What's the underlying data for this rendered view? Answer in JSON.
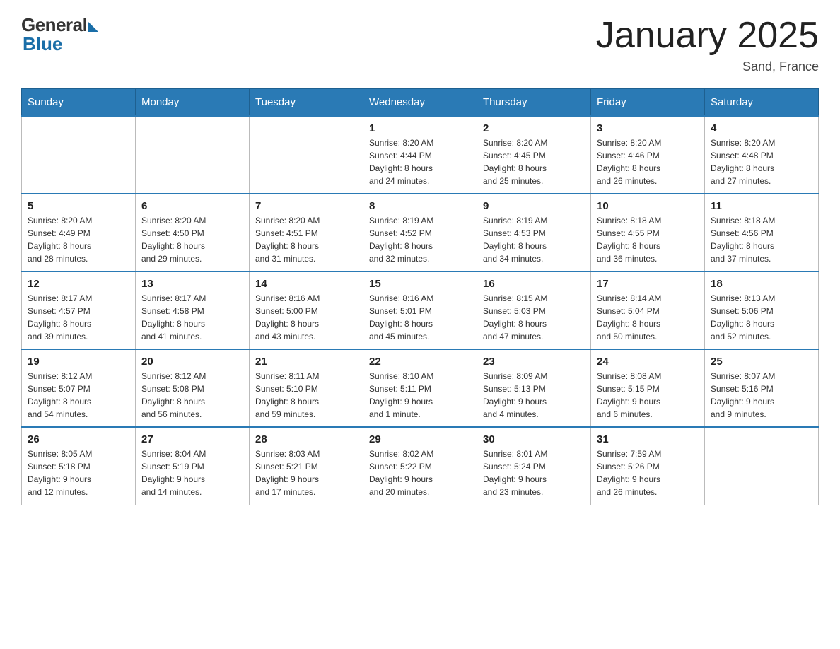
{
  "header": {
    "logo_general": "General",
    "logo_blue": "Blue",
    "title": "January 2025",
    "location": "Sand, France"
  },
  "days_of_week": [
    "Sunday",
    "Monday",
    "Tuesday",
    "Wednesday",
    "Thursday",
    "Friday",
    "Saturday"
  ],
  "weeks": [
    [
      {
        "day": "",
        "info": ""
      },
      {
        "day": "",
        "info": ""
      },
      {
        "day": "",
        "info": ""
      },
      {
        "day": "1",
        "info": "Sunrise: 8:20 AM\nSunset: 4:44 PM\nDaylight: 8 hours\nand 24 minutes."
      },
      {
        "day": "2",
        "info": "Sunrise: 8:20 AM\nSunset: 4:45 PM\nDaylight: 8 hours\nand 25 minutes."
      },
      {
        "day": "3",
        "info": "Sunrise: 8:20 AM\nSunset: 4:46 PM\nDaylight: 8 hours\nand 26 minutes."
      },
      {
        "day": "4",
        "info": "Sunrise: 8:20 AM\nSunset: 4:48 PM\nDaylight: 8 hours\nand 27 minutes."
      }
    ],
    [
      {
        "day": "5",
        "info": "Sunrise: 8:20 AM\nSunset: 4:49 PM\nDaylight: 8 hours\nand 28 minutes."
      },
      {
        "day": "6",
        "info": "Sunrise: 8:20 AM\nSunset: 4:50 PM\nDaylight: 8 hours\nand 29 minutes."
      },
      {
        "day": "7",
        "info": "Sunrise: 8:20 AM\nSunset: 4:51 PM\nDaylight: 8 hours\nand 31 minutes."
      },
      {
        "day": "8",
        "info": "Sunrise: 8:19 AM\nSunset: 4:52 PM\nDaylight: 8 hours\nand 32 minutes."
      },
      {
        "day": "9",
        "info": "Sunrise: 8:19 AM\nSunset: 4:53 PM\nDaylight: 8 hours\nand 34 minutes."
      },
      {
        "day": "10",
        "info": "Sunrise: 8:18 AM\nSunset: 4:55 PM\nDaylight: 8 hours\nand 36 minutes."
      },
      {
        "day": "11",
        "info": "Sunrise: 8:18 AM\nSunset: 4:56 PM\nDaylight: 8 hours\nand 37 minutes."
      }
    ],
    [
      {
        "day": "12",
        "info": "Sunrise: 8:17 AM\nSunset: 4:57 PM\nDaylight: 8 hours\nand 39 minutes."
      },
      {
        "day": "13",
        "info": "Sunrise: 8:17 AM\nSunset: 4:58 PM\nDaylight: 8 hours\nand 41 minutes."
      },
      {
        "day": "14",
        "info": "Sunrise: 8:16 AM\nSunset: 5:00 PM\nDaylight: 8 hours\nand 43 minutes."
      },
      {
        "day": "15",
        "info": "Sunrise: 8:16 AM\nSunset: 5:01 PM\nDaylight: 8 hours\nand 45 minutes."
      },
      {
        "day": "16",
        "info": "Sunrise: 8:15 AM\nSunset: 5:03 PM\nDaylight: 8 hours\nand 47 minutes."
      },
      {
        "day": "17",
        "info": "Sunrise: 8:14 AM\nSunset: 5:04 PM\nDaylight: 8 hours\nand 50 minutes."
      },
      {
        "day": "18",
        "info": "Sunrise: 8:13 AM\nSunset: 5:06 PM\nDaylight: 8 hours\nand 52 minutes."
      }
    ],
    [
      {
        "day": "19",
        "info": "Sunrise: 8:12 AM\nSunset: 5:07 PM\nDaylight: 8 hours\nand 54 minutes."
      },
      {
        "day": "20",
        "info": "Sunrise: 8:12 AM\nSunset: 5:08 PM\nDaylight: 8 hours\nand 56 minutes."
      },
      {
        "day": "21",
        "info": "Sunrise: 8:11 AM\nSunset: 5:10 PM\nDaylight: 8 hours\nand 59 minutes."
      },
      {
        "day": "22",
        "info": "Sunrise: 8:10 AM\nSunset: 5:11 PM\nDaylight: 9 hours\nand 1 minute."
      },
      {
        "day": "23",
        "info": "Sunrise: 8:09 AM\nSunset: 5:13 PM\nDaylight: 9 hours\nand 4 minutes."
      },
      {
        "day": "24",
        "info": "Sunrise: 8:08 AM\nSunset: 5:15 PM\nDaylight: 9 hours\nand 6 minutes."
      },
      {
        "day": "25",
        "info": "Sunrise: 8:07 AM\nSunset: 5:16 PM\nDaylight: 9 hours\nand 9 minutes."
      }
    ],
    [
      {
        "day": "26",
        "info": "Sunrise: 8:05 AM\nSunset: 5:18 PM\nDaylight: 9 hours\nand 12 minutes."
      },
      {
        "day": "27",
        "info": "Sunrise: 8:04 AM\nSunset: 5:19 PM\nDaylight: 9 hours\nand 14 minutes."
      },
      {
        "day": "28",
        "info": "Sunrise: 8:03 AM\nSunset: 5:21 PM\nDaylight: 9 hours\nand 17 minutes."
      },
      {
        "day": "29",
        "info": "Sunrise: 8:02 AM\nSunset: 5:22 PM\nDaylight: 9 hours\nand 20 minutes."
      },
      {
        "day": "30",
        "info": "Sunrise: 8:01 AM\nSunset: 5:24 PM\nDaylight: 9 hours\nand 23 minutes."
      },
      {
        "day": "31",
        "info": "Sunrise: 7:59 AM\nSunset: 5:26 PM\nDaylight: 9 hours\nand 26 minutes."
      },
      {
        "day": "",
        "info": ""
      }
    ]
  ]
}
